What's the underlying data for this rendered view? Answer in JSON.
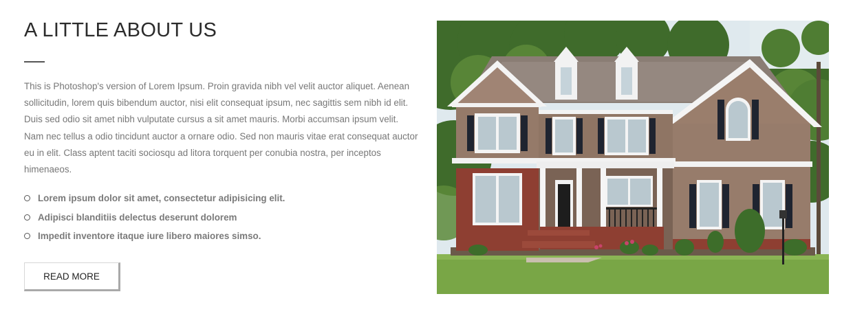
{
  "about": {
    "title": "A LITTLE ABOUT US",
    "paragraph": "This is Photoshop's version of Lorem Ipsum. Proin gravida nibh vel velit auctor aliquet. Aenean sollicitudin, lorem quis bibendum auctor, nisi elit consequat ipsum, nec sagittis sem nibh id elit. Duis sed odio sit amet nibh vulputate cursus a sit amet mauris. Morbi accumsan ipsum velit. Nam nec tellus a odio tincidunt auctor a ornare odio. Sed non mauris vitae erat consequat auctor eu in elit. Class aptent taciti sociosqu ad litora torquent per conubia nostra, per inceptos himenaeos.",
    "features": [
      "Lorem ipsum dolor sit amet, consectetur adipisicing elit.",
      "Adipisci blanditiis delectus deserunt dolorem",
      "Impedit inventore itaque iure libero maiores simso."
    ],
    "button_label": "READ MORE"
  },
  "photo": {
    "subject": "house-photo"
  }
}
